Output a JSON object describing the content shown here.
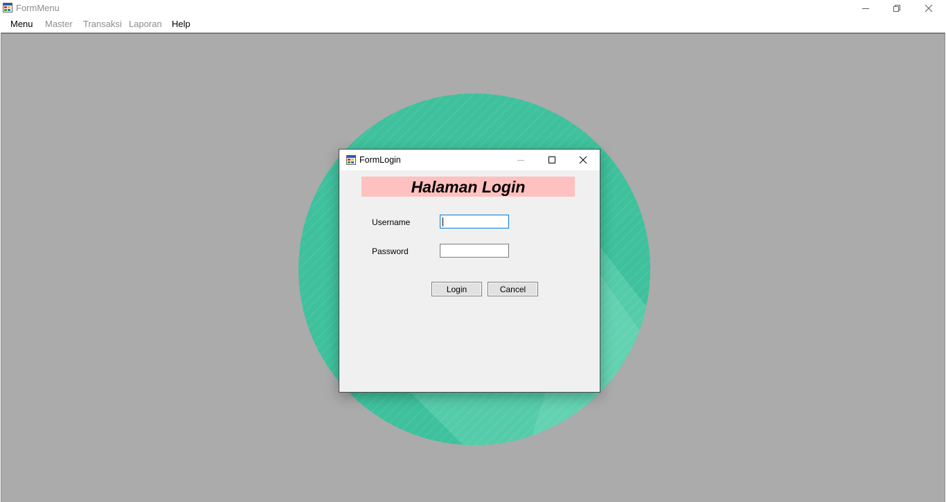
{
  "main_window": {
    "title": "FormMenu"
  },
  "menu": [
    {
      "label": "Menu",
      "enabled": true
    },
    {
      "label": "Master",
      "enabled": false
    },
    {
      "label": "Transaksi",
      "enabled": false
    },
    {
      "label": "Laporan",
      "enabled": false
    },
    {
      "label": "Help",
      "enabled": true
    }
  ],
  "background": {
    "circle_color": "#3ec19c",
    "mdi_color": "#ababab"
  },
  "login_window": {
    "title": "FormLogin",
    "header": "Halaman Login",
    "header_bg": "#ffc0c0",
    "username_label": "Username",
    "username_value": "",
    "password_label": "Password",
    "password_value": "",
    "login_button": "Login",
    "cancel_button": "Cancel"
  },
  "icons": {
    "app": "form-icon",
    "minimize": "minimize-icon",
    "restore": "restore-icon",
    "maximize": "maximize-icon",
    "close": "close-icon"
  }
}
